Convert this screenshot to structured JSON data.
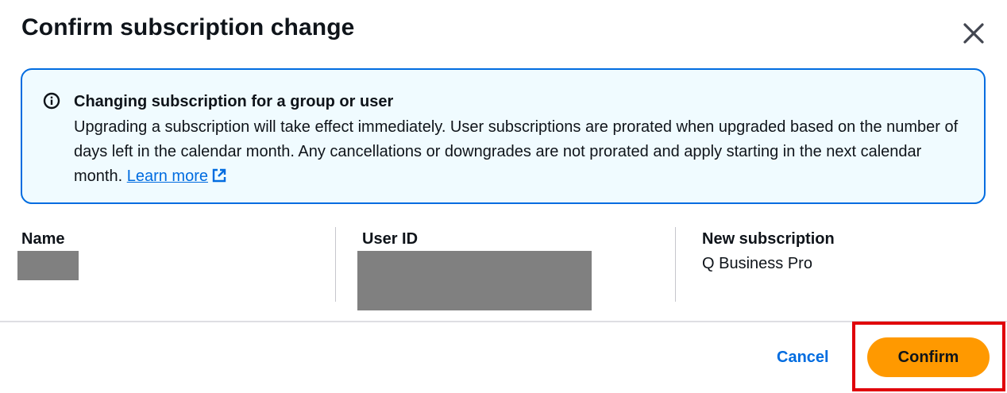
{
  "dialog": {
    "title": "Confirm subscription change"
  },
  "alert": {
    "icon": "info-icon",
    "title": "Changing subscription for a group or user",
    "body": "Upgrading a subscription will take effect immediately. User subscriptions are prorated when upgraded based on the number of days left in the calendar month. Any cancellations or downgrades are not prorated and apply starting in the next calendar month. ",
    "link_label": "Learn more",
    "link_icon": "external-link-icon"
  },
  "details": {
    "name_label": "Name",
    "user_id_label": "User ID",
    "subscription_label": "New subscription",
    "subscription_value": "Q Business Pro"
  },
  "footer": {
    "cancel_label": "Cancel",
    "confirm_label": "Confirm"
  },
  "colors": {
    "primary_button": "#ff9900",
    "link": "#006ce0",
    "alert_border": "#006ce0",
    "alert_background": "#f0fbff",
    "highlight_box": "#e0000a",
    "redaction": "#808080"
  }
}
